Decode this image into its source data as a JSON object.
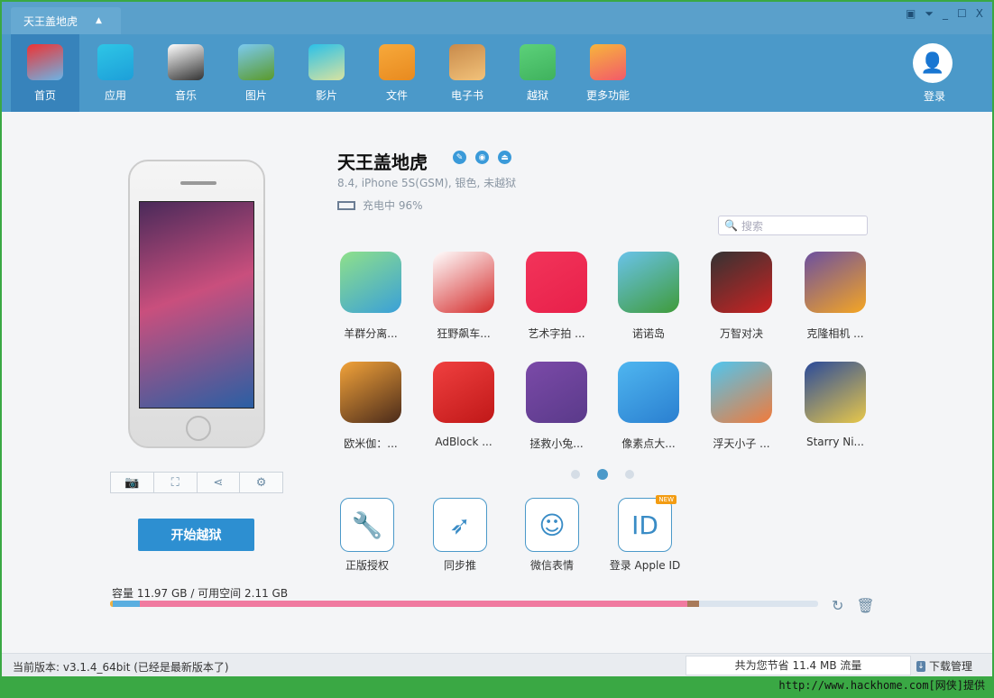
{
  "title": {
    "device_tab": "天王盖地虎",
    "controls": [
      "feedback",
      "menu",
      "minimize",
      "maximize",
      "close"
    ]
  },
  "toolbar": {
    "items": [
      {
        "label": "首页",
        "icon": "store-icon",
        "colors": [
          "#e33",
          "#6cb4e6"
        ],
        "active": true
      },
      {
        "label": "应用",
        "icon": "appstore-icon",
        "colors": [
          "#2ec6e6",
          "#1d9fd9"
        ]
      },
      {
        "label": "音乐",
        "icon": "music-disc-icon",
        "colors": [
          "#fff",
          "#333"
        ]
      },
      {
        "label": "图片",
        "icon": "photo-icon",
        "colors": [
          "#7ccaf0",
          "#5a9a2a"
        ]
      },
      {
        "label": "影片",
        "icon": "clapper-icon",
        "colors": [
          "#2bc0e8",
          "#d8e3a0"
        ]
      },
      {
        "label": "文件",
        "icon": "envelope-icon",
        "colors": [
          "#f7a93b",
          "#e88a1f"
        ]
      },
      {
        "label": "电子书",
        "icon": "book-icon",
        "colors": [
          "#c88a4a",
          "#f2c27a"
        ]
      },
      {
        "label": "越狱",
        "icon": "pineapple-icon",
        "colors": [
          "#5cd17a",
          "#3fb25d"
        ]
      },
      {
        "label": "更多功能",
        "icon": "tiles-icon",
        "colors": [
          "#f7b53b",
          "#f25a6a"
        ]
      }
    ],
    "login": "登录"
  },
  "device": {
    "name": "天王盖地虎",
    "info": "8.4, iPhone 5S(GSM), 银色, 未越狱",
    "battery": "充电中 96%",
    "battery_percent": 96,
    "jailbreak_button": "开始越狱"
  },
  "search": {
    "placeholder": "搜索"
  },
  "apps": [
    {
      "label": "羊群分离...",
      "colors": [
        "#8fe08a",
        "#3aa0d8"
      ]
    },
    {
      "label": "狂野飙车...",
      "colors": [
        "#fff",
        "#d42a2a"
      ]
    },
    {
      "label": "艺术字拍 ...",
      "colors": [
        "#f2345a",
        "#e8204a"
      ]
    },
    {
      "label": "诺诺岛",
      "colors": [
        "#6ac3ea",
        "#3f9b3a"
      ]
    },
    {
      "label": "万智对决",
      "colors": [
        "#333",
        "#c22"
      ]
    },
    {
      "label": "克隆相机 ...",
      "colors": [
        "#6b4fa0",
        "#f5a623"
      ]
    },
    {
      "label": "欧米伽：...",
      "colors": [
        "#f2a33a",
        "#4a2a1a"
      ]
    },
    {
      "label": "AdBlock ...",
      "colors": [
        "#f04040",
        "#c01818"
      ]
    },
    {
      "label": "拯救小兔...",
      "colors": [
        "#7b4aa8",
        "#5a3a8a"
      ]
    },
    {
      "label": "像素点大...",
      "colors": [
        "#4fb6f0",
        "#2a7fd0"
      ]
    },
    {
      "label": "浮天小子 ...",
      "colors": [
        "#4fc6f0",
        "#f27a3a"
      ]
    },
    {
      "label": "Starry Ni...",
      "colors": [
        "#2a4a9a",
        "#e8c84a"
      ]
    }
  ],
  "pager": {
    "pages": 3,
    "current": 2
  },
  "tools": [
    {
      "label": "正版授权",
      "icon": "wrench-icon",
      "glyph": "🔧"
    },
    {
      "label": "同步推",
      "icon": "tongbutui-icon",
      "glyph": "➶"
    },
    {
      "label": "微信表情",
      "icon": "smiley-icon",
      "glyph": "☺"
    },
    {
      "label": "登录 Apple ID",
      "icon": "apple-id-icon",
      "glyph": "ID",
      "badge": "NEW"
    }
  ],
  "storage": {
    "label": "容量  11.97 GB / 可用空间  2.11 GB",
    "segments": [
      {
        "fraction": 0.004,
        "color": "#f0b040"
      },
      {
        "fraction": 0.038,
        "color": "#5aaee0"
      },
      {
        "fraction": 0.773,
        "color": "#f07aa0"
      },
      {
        "fraction": 0.017,
        "color": "#a87a5a"
      }
    ]
  },
  "status": {
    "version": "当前版本: v3.1.4_64bit    (已经是最新版本了)",
    "saved": "共为您节省  11.4 MB 流量",
    "download": "下载管理"
  },
  "credit": "http://www.hackhome.com[网侠]提供"
}
